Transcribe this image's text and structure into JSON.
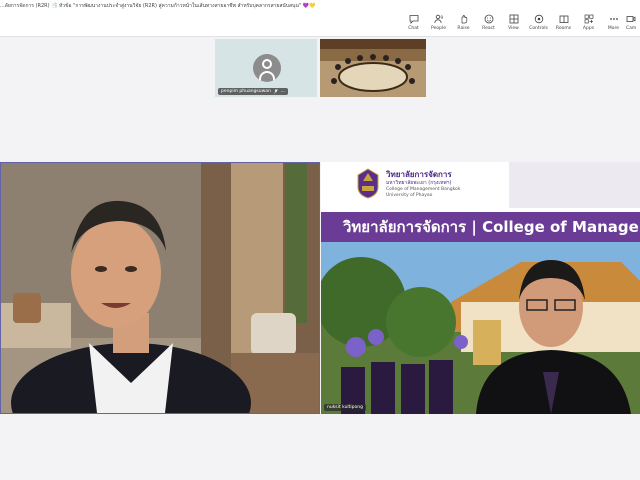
{
  "meeting": {
    "title": "...ลัยการจัดการ (R2R) 📑 หัวข้อ \"การพัฒนางานประจำสู่งานวิจัย (R2R) สู่ความก้าวหน้าในเส้นทางสายอาชีพ สำหรับบุคลากรสายสนับสนุน\" 💜💛"
  },
  "controls": [
    {
      "id": "chat",
      "label": "Chat",
      "icon": "chat-icon"
    },
    {
      "id": "people",
      "label": "People",
      "icon": "people-icon"
    },
    {
      "id": "raise",
      "label": "Raise",
      "icon": "raise-hand-icon"
    },
    {
      "id": "react",
      "label": "React",
      "icon": "react-icon"
    },
    {
      "id": "view",
      "label": "View",
      "icon": "view-icon"
    },
    {
      "id": "controls",
      "label": "Controls",
      "icon": "controls-icon"
    },
    {
      "id": "rooms",
      "label": "Rooms",
      "icon": "rooms-icon"
    },
    {
      "id": "apps",
      "label": "Apps",
      "icon": "apps-icon"
    },
    {
      "id": "more",
      "label": "More",
      "icon": "more-icon"
    },
    {
      "id": "camera",
      "label": "Cam",
      "icon": "camera-icon"
    }
  ],
  "participants": {
    "small": [
      {
        "name": "penpim phuangsuwan",
        "muted": true
      },
      {
        "name": ""
      }
    ],
    "right_tile_name": "nuksit kultipong",
    "slide": {
      "th_title": "วิทยาลัยการจัดการ",
      "th_sub": "มหาวิทยาลัยพะเยา (กรุงเทพฯ)",
      "en_line1": "College of Management Bangkok",
      "en_line2": "University of Phayao",
      "banner": "วิทยาลัยการจัดการ | College of Management"
    }
  },
  "colors": {
    "accent": "#6264a7",
    "purple": "#6a3c96"
  }
}
